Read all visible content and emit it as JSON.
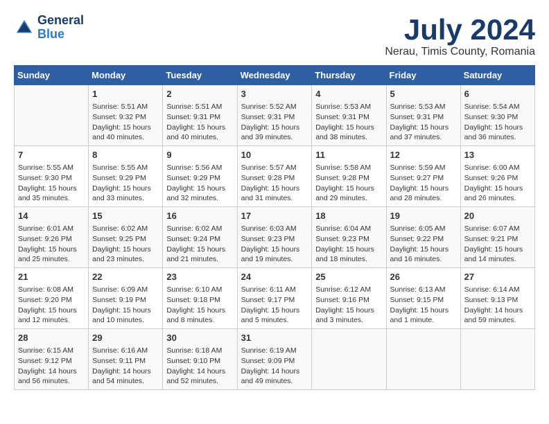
{
  "logo": {
    "line1": "General",
    "line2": "Blue"
  },
  "title": "July 2024",
  "subtitle": "Nerau, Timis County, Romania",
  "days_of_week": [
    "Sunday",
    "Monday",
    "Tuesday",
    "Wednesday",
    "Thursday",
    "Friday",
    "Saturday"
  ],
  "weeks": [
    [
      {
        "day": "",
        "info": ""
      },
      {
        "day": "1",
        "info": "Sunrise: 5:51 AM\nSunset: 9:32 PM\nDaylight: 15 hours\nand 40 minutes."
      },
      {
        "day": "2",
        "info": "Sunrise: 5:51 AM\nSunset: 9:31 PM\nDaylight: 15 hours\nand 40 minutes."
      },
      {
        "day": "3",
        "info": "Sunrise: 5:52 AM\nSunset: 9:31 PM\nDaylight: 15 hours\nand 39 minutes."
      },
      {
        "day": "4",
        "info": "Sunrise: 5:53 AM\nSunset: 9:31 PM\nDaylight: 15 hours\nand 38 minutes."
      },
      {
        "day": "5",
        "info": "Sunrise: 5:53 AM\nSunset: 9:31 PM\nDaylight: 15 hours\nand 37 minutes."
      },
      {
        "day": "6",
        "info": "Sunrise: 5:54 AM\nSunset: 9:30 PM\nDaylight: 15 hours\nand 36 minutes."
      }
    ],
    [
      {
        "day": "7",
        "info": "Sunrise: 5:55 AM\nSunset: 9:30 PM\nDaylight: 15 hours\nand 35 minutes."
      },
      {
        "day": "8",
        "info": "Sunrise: 5:55 AM\nSunset: 9:29 PM\nDaylight: 15 hours\nand 33 minutes."
      },
      {
        "day": "9",
        "info": "Sunrise: 5:56 AM\nSunset: 9:29 PM\nDaylight: 15 hours\nand 32 minutes."
      },
      {
        "day": "10",
        "info": "Sunrise: 5:57 AM\nSunset: 9:28 PM\nDaylight: 15 hours\nand 31 minutes."
      },
      {
        "day": "11",
        "info": "Sunrise: 5:58 AM\nSunset: 9:28 PM\nDaylight: 15 hours\nand 29 minutes."
      },
      {
        "day": "12",
        "info": "Sunrise: 5:59 AM\nSunset: 9:27 PM\nDaylight: 15 hours\nand 28 minutes."
      },
      {
        "day": "13",
        "info": "Sunrise: 6:00 AM\nSunset: 9:26 PM\nDaylight: 15 hours\nand 26 minutes."
      }
    ],
    [
      {
        "day": "14",
        "info": "Sunrise: 6:01 AM\nSunset: 9:26 PM\nDaylight: 15 hours\nand 25 minutes."
      },
      {
        "day": "15",
        "info": "Sunrise: 6:02 AM\nSunset: 9:25 PM\nDaylight: 15 hours\nand 23 minutes."
      },
      {
        "day": "16",
        "info": "Sunrise: 6:02 AM\nSunset: 9:24 PM\nDaylight: 15 hours\nand 21 minutes."
      },
      {
        "day": "17",
        "info": "Sunrise: 6:03 AM\nSunset: 9:23 PM\nDaylight: 15 hours\nand 19 minutes."
      },
      {
        "day": "18",
        "info": "Sunrise: 6:04 AM\nSunset: 9:23 PM\nDaylight: 15 hours\nand 18 minutes."
      },
      {
        "day": "19",
        "info": "Sunrise: 6:05 AM\nSunset: 9:22 PM\nDaylight: 15 hours\nand 16 minutes."
      },
      {
        "day": "20",
        "info": "Sunrise: 6:07 AM\nSunset: 9:21 PM\nDaylight: 15 hours\nand 14 minutes."
      }
    ],
    [
      {
        "day": "21",
        "info": "Sunrise: 6:08 AM\nSunset: 9:20 PM\nDaylight: 15 hours\nand 12 minutes."
      },
      {
        "day": "22",
        "info": "Sunrise: 6:09 AM\nSunset: 9:19 PM\nDaylight: 15 hours\nand 10 minutes."
      },
      {
        "day": "23",
        "info": "Sunrise: 6:10 AM\nSunset: 9:18 PM\nDaylight: 15 hours\nand 8 minutes."
      },
      {
        "day": "24",
        "info": "Sunrise: 6:11 AM\nSunset: 9:17 PM\nDaylight: 15 hours\nand 5 minutes."
      },
      {
        "day": "25",
        "info": "Sunrise: 6:12 AM\nSunset: 9:16 PM\nDaylight: 15 hours\nand 3 minutes."
      },
      {
        "day": "26",
        "info": "Sunrise: 6:13 AM\nSunset: 9:15 PM\nDaylight: 15 hours\nand 1 minute."
      },
      {
        "day": "27",
        "info": "Sunrise: 6:14 AM\nSunset: 9:13 PM\nDaylight: 14 hours\nand 59 minutes."
      }
    ],
    [
      {
        "day": "28",
        "info": "Sunrise: 6:15 AM\nSunset: 9:12 PM\nDaylight: 14 hours\nand 56 minutes."
      },
      {
        "day": "29",
        "info": "Sunrise: 6:16 AM\nSunset: 9:11 PM\nDaylight: 14 hours\nand 54 minutes."
      },
      {
        "day": "30",
        "info": "Sunrise: 6:18 AM\nSunset: 9:10 PM\nDaylight: 14 hours\nand 52 minutes."
      },
      {
        "day": "31",
        "info": "Sunrise: 6:19 AM\nSunset: 9:09 PM\nDaylight: 14 hours\nand 49 minutes."
      },
      {
        "day": "",
        "info": ""
      },
      {
        "day": "",
        "info": ""
      },
      {
        "day": "",
        "info": ""
      }
    ]
  ]
}
